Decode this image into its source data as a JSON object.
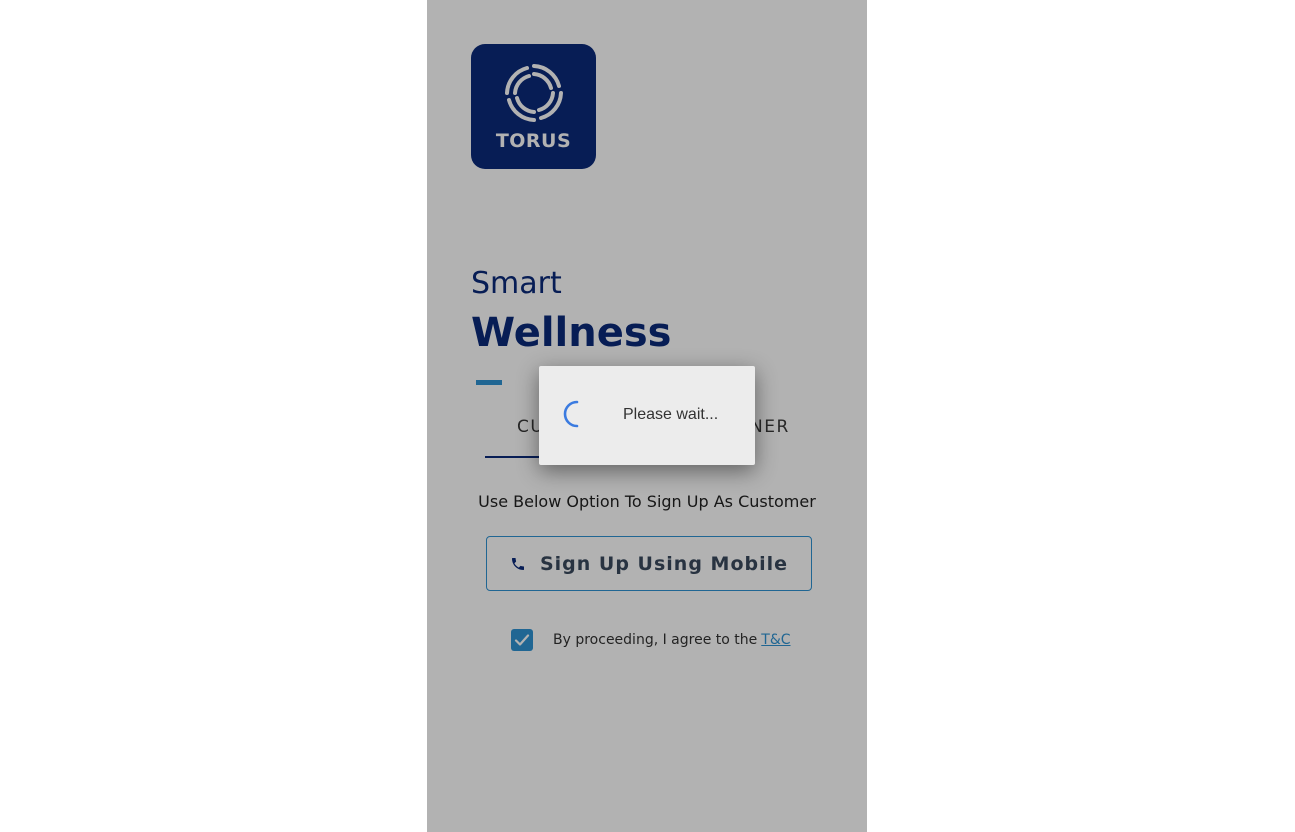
{
  "brand": {
    "logo_text": "TORUS",
    "logo_color": "#0b2a7a"
  },
  "hero": {
    "title_small": "Smart",
    "title_big": "Wellness"
  },
  "tabs": [
    {
      "label": "CUSTOMER",
      "active": true
    },
    {
      "label": "PARTNER",
      "active": false
    }
  ],
  "signup": {
    "subtitle": "Use Below Option To Sign Up As Customer",
    "button_label": "Sign Up Using Mobile",
    "button_icon": "phone-icon"
  },
  "terms": {
    "checked": true,
    "text": "By proceeding, I agree to the",
    "link": "T&C"
  },
  "loading_dialog": {
    "message": "Please wait..."
  },
  "colors": {
    "accent": "#2f93d3",
    "navy": "#0b2a7a"
  }
}
